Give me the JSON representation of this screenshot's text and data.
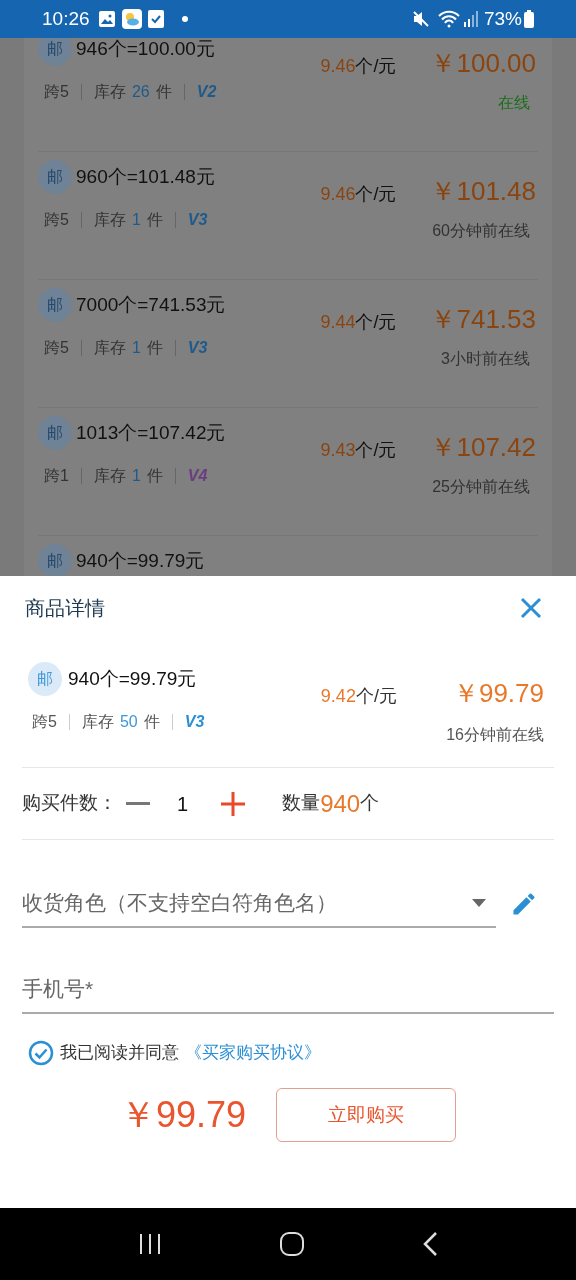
{
  "status_bar": {
    "time": "10:26",
    "battery": "73%"
  },
  "listings": [
    {
      "badge": "邮",
      "title": "946个=100.00元",
      "cross": "跨5",
      "stock_label": "库存",
      "stock": "26",
      "stock_unit": "件",
      "version": {
        "text": "V2",
        "color": "#1f5a8a"
      },
      "rate": "9.46",
      "rate_unit": "个/元",
      "price": "￥100.00",
      "status": {
        "text": "在线",
        "color": "#1c6e1c"
      }
    },
    {
      "badge": "邮",
      "title": "960个=101.48元",
      "cross": "跨5",
      "stock_label": "库存",
      "stock": "1",
      "stock_unit": "件",
      "version": {
        "text": "V3",
        "color": "#1f5a8a"
      },
      "rate": "9.46",
      "rate_unit": "个/元",
      "price": "￥101.48",
      "status": {
        "text": "60分钟前在线",
        "color": "#333333"
      }
    },
    {
      "badge": "邮",
      "title": "7000个=741.53元",
      "cross": "跨5",
      "stock_label": "库存",
      "stock": "1",
      "stock_unit": "件",
      "version": {
        "text": "V3",
        "color": "#1f5a8a"
      },
      "rate": "9.44",
      "rate_unit": "个/元",
      "price": "￥741.53",
      "status": {
        "text": "3小时前在线",
        "color": "#333333"
      }
    },
    {
      "badge": "邮",
      "title": "1013个=107.42元",
      "cross": "跨1",
      "stock_label": "库存",
      "stock": "1",
      "stock_unit": "件",
      "version": {
        "text": "V4",
        "color": "#6a3d80"
      },
      "rate": "9.43",
      "rate_unit": "个/元",
      "price": "￥107.42",
      "status": {
        "text": "25分钟前在线",
        "color": "#333333"
      }
    },
    {
      "badge": "邮",
      "title": "940个=99.79元"
    }
  ],
  "sheet": {
    "title": "商品详情",
    "product": {
      "badge": "邮",
      "title": "940个=99.79元",
      "cross": "跨5",
      "stock_label": "库存",
      "stock": "50",
      "stock_unit": "件",
      "version": "V3",
      "rate": "9.42",
      "rate_unit": "个/元",
      "price": "￥99.79",
      "status": "16分钟前在线"
    },
    "quantity": {
      "label": "购买件数：",
      "value": "1",
      "amount_label": "数量",
      "amount": "940",
      "amount_unit": "个"
    },
    "role_field": {
      "placeholder": "收货角色（不支持空白符角色名）"
    },
    "phone_field": {
      "placeholder": "手机号*"
    },
    "agreement": {
      "checked": true,
      "text": "我已阅读并同意",
      "link": "《买家购买协议》"
    },
    "total": "￥99.79",
    "buy_button": "立即购买"
  }
}
